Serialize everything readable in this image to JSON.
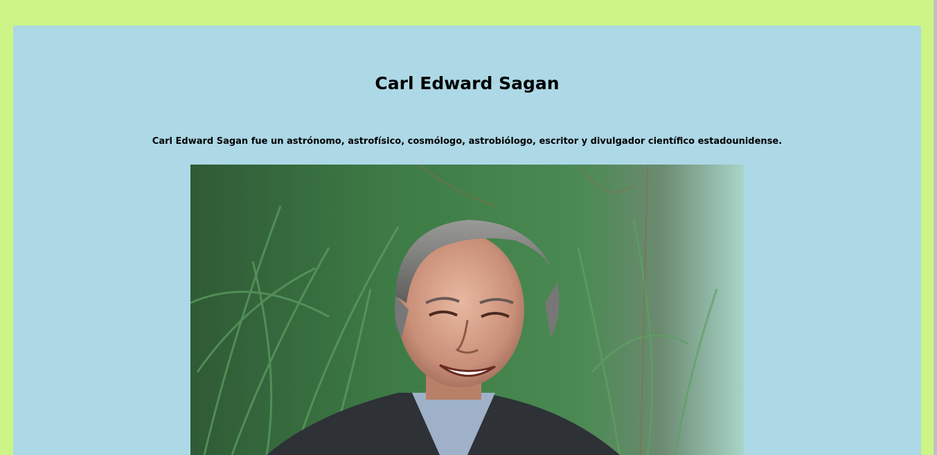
{
  "page": {
    "title": "Carl Edward Sagan",
    "description": "Carl Edward Sagan fue un astrónomo, astrofísico, cosmólogo, astrobiólogo, escritor y divulgador científico estadounidense."
  },
  "colors": {
    "page_background": "#ccf486",
    "card_background": "#add8e6",
    "text": "#000000"
  },
  "image": {
    "subject": "portrait-photo"
  }
}
